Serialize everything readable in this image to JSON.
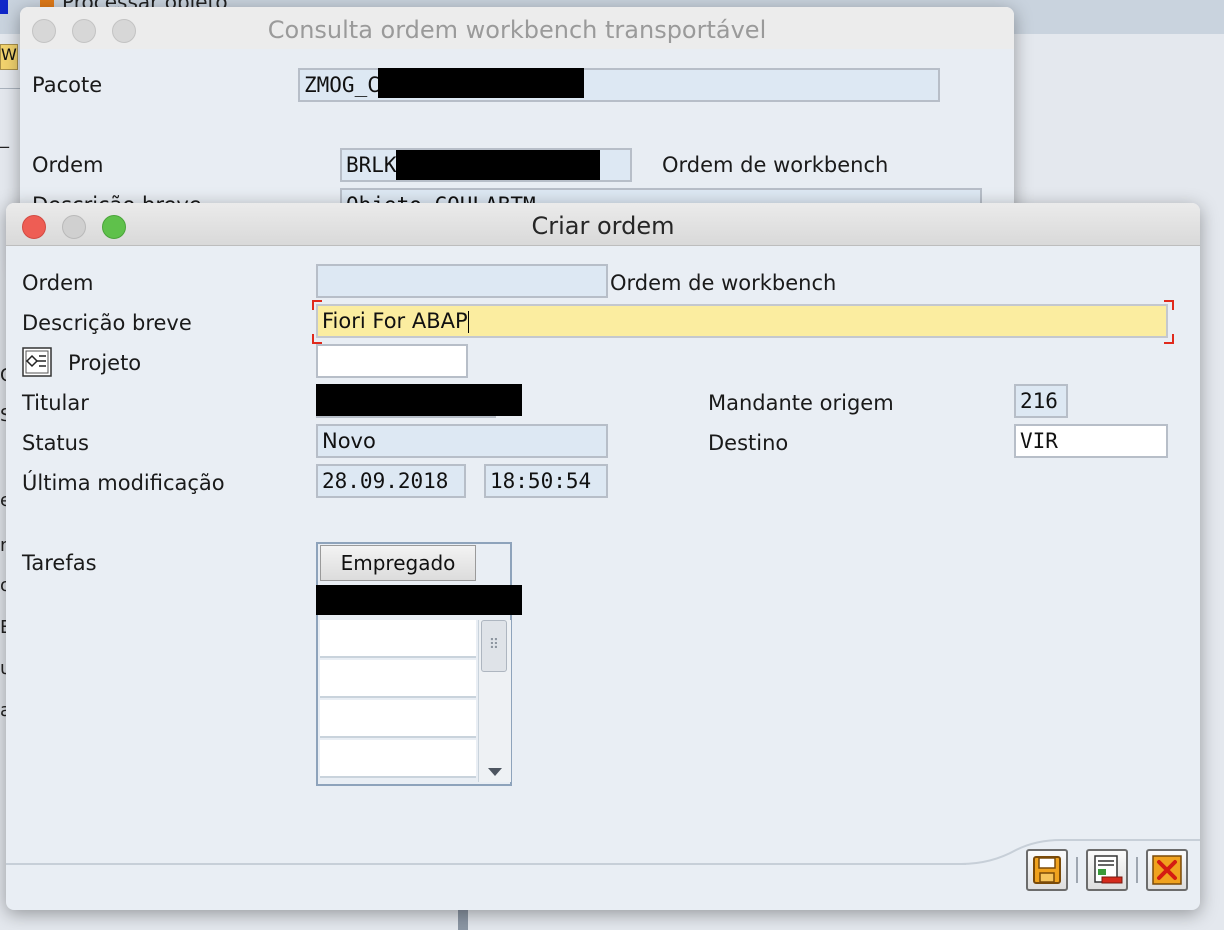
{
  "background_app": {
    "top_text": "Processar objeto",
    "side_chars": [
      "W",
      "_2",
      "C",
      "S",
      "e",
      "n",
      "o",
      "E",
      "u",
      "a"
    ]
  },
  "back_window": {
    "title": "Consulta ordem workbench transportável",
    "pacote_label": "Pacote",
    "pacote_value": "ZMOG_C",
    "ordem_label": "Ordem",
    "ordem_value": "BRLK",
    "ordem_type": "Ordem de workbench",
    "descricao_label": "Descrição breve",
    "descricao_value": "Objeto COULABTM"
  },
  "front_window": {
    "title": "Criar ordem",
    "ordem_label": "Ordem",
    "ordem_value": "",
    "ordem_type": "Ordem de workbench",
    "descricao_label": "Descrição breve",
    "descricao_value": "Fiori For ABAP",
    "projeto_label": "Projeto",
    "projeto_value": "",
    "titular_label": "Titular",
    "status_label": "Status",
    "status_value": "Novo",
    "ultima_label": "Última modificação",
    "ultima_date": "28.09.2018",
    "ultima_time": "18:50:54",
    "mandante_label": "Mandante origem",
    "mandante_value": "216",
    "destino_label": "Destino",
    "destino_value": "VIR",
    "tarefas_label": "Tarefas",
    "tarefas_column": "Empregado"
  },
  "colors": {
    "input_bg": "#dde8f3",
    "active_input_bg": "#fbeda0",
    "focus_corner": "#e02a1c",
    "close_light": "#ee5d54",
    "min_light": "#d0d0d0",
    "zoom_light": "#5fc14b"
  },
  "footer_buttons": {
    "save": "save-icon",
    "other": "list-edit-icon",
    "cancel": "cancel-icon"
  }
}
